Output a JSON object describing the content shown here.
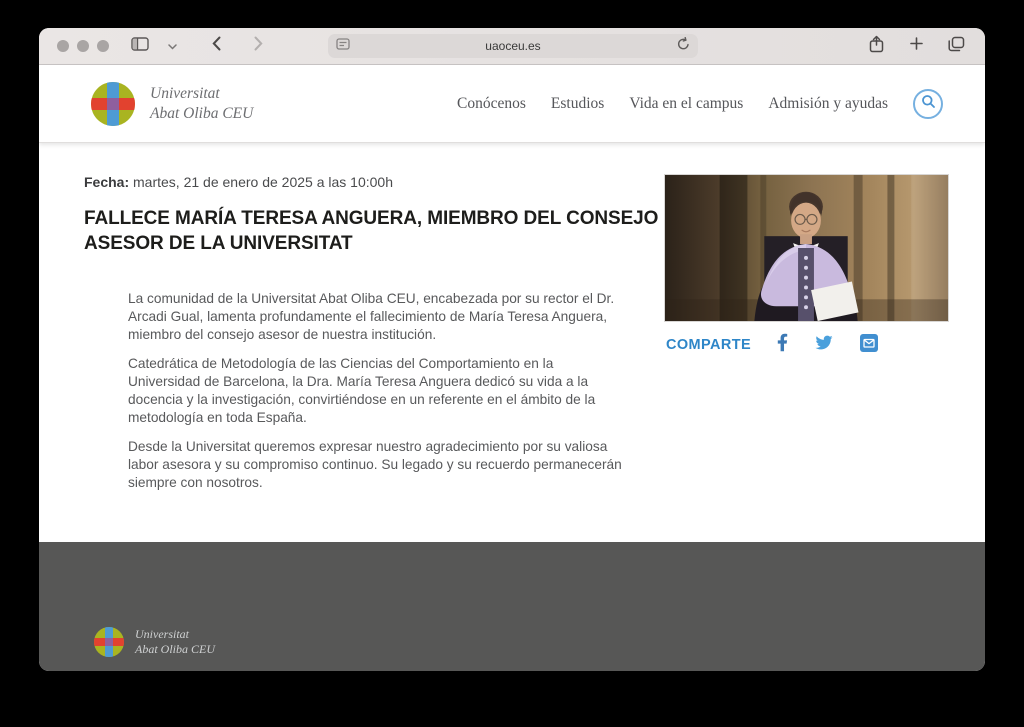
{
  "browser": {
    "url": "uaoceu.es",
    "toolbar_icons": [
      "sidebar-icon",
      "chevron-down-icon",
      "back-icon",
      "forward-icon",
      "reader-icon",
      "reload-icon",
      "share-icon",
      "plus-icon",
      "tab-overview-icon"
    ]
  },
  "header": {
    "logo_line1": "Universitat",
    "logo_line2": "Abat Oliba CEU",
    "nav": [
      {
        "label": "Conócenos"
      },
      {
        "label": "Estudios"
      },
      {
        "label": "Vida en el campus"
      },
      {
        "label": "Admisión y ayudas"
      }
    ],
    "search_icon": "magnifier-in-circle"
  },
  "article": {
    "date_label": "Fecha:",
    "date_value": " martes, 21 de enero de 2025 a las 10:00h",
    "title": "FALLECE MARÍA TERESA ANGUERA, MIEMBRO DEL CONSEJO ASESOR DE LA UNIVERSITAT",
    "paragraphs": [
      "La comunidad de la Universitat Abat Oliba CEU, encabezada por su rector el Dr. Arcadi Gual, lamenta profundamente el fallecimiento de María Teresa Anguera, miembro del consejo asesor de nuestra institución.",
      "Catedrática de Metodología de las Ciencias del Comportamiento en la Universidad de Barcelona, la Dra. María Teresa Anguera dedicó su vida a la docencia y la investigación, convirtiéndose en un referente en el ámbito de la metodología en toda España.",
      "Desde la Universitat queremos expresar nuestro agradecimiento por su valiosa labor asesora y su compromiso continuo. Su legado y su recuerdo permanecerán siempre con nosotros."
    ],
    "photo_alt": "woman-in-academic-regalia-lilac-hood-stone-cloister"
  },
  "share": {
    "label": "COMPARTE",
    "icons": [
      "facebook-icon",
      "twitter-icon",
      "email-icon"
    ]
  },
  "footer": {
    "logo_line1": "Universitat",
    "logo_line2": "Abat Oliba CEU"
  },
  "colors": {
    "accent_blue": "#2e86c8",
    "search_blue": "#76b0e0",
    "facebook_blue": "#3c79b5",
    "twitter_blue": "#4aa0dc",
    "email_blue": "#418fd0",
    "logo_green": "#a9b421",
    "logo_blue": "#4e9bd4",
    "logo_red": "#e2422f",
    "footer_bg": "#575756",
    "headline_text": "#1d1d1b",
    "body_text": "#58595b"
  }
}
